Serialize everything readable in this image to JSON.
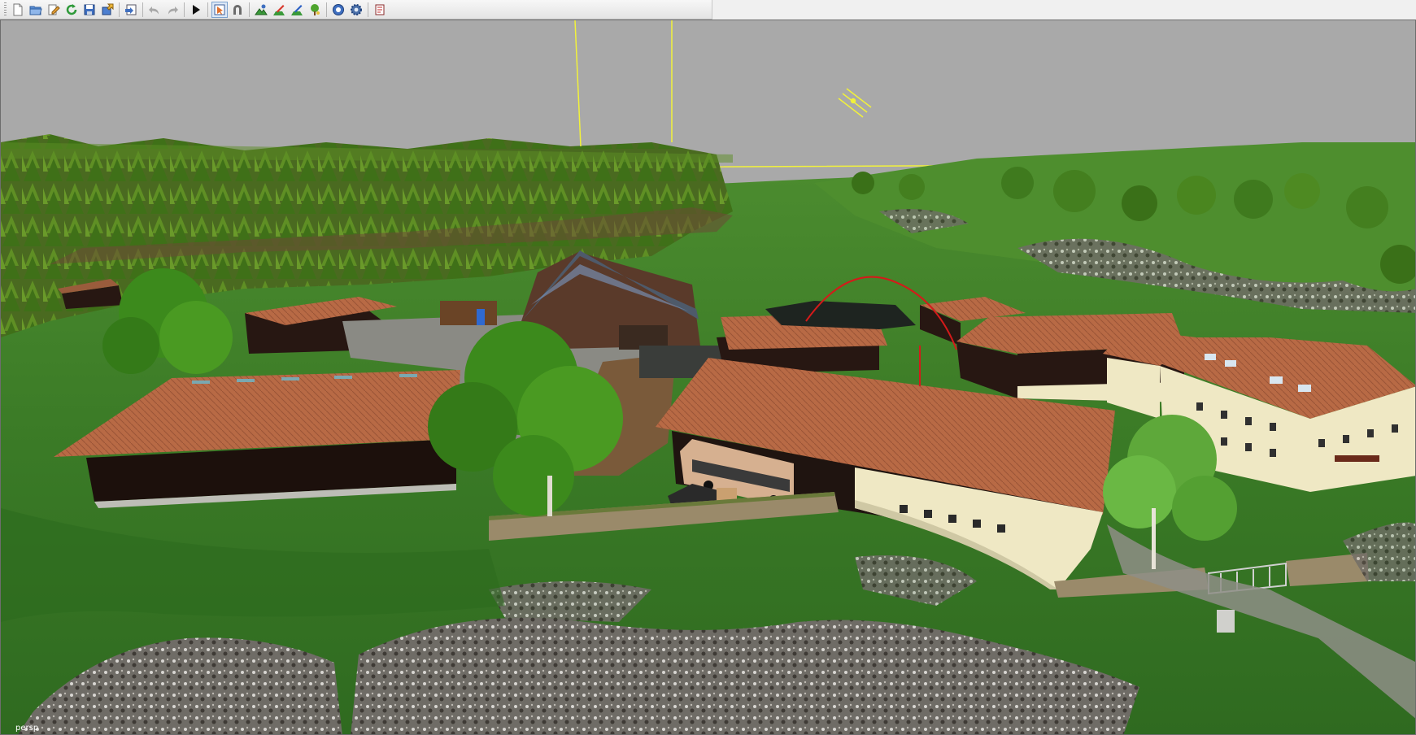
{
  "toolbar": {
    "buttons": [
      {
        "name": "new-file",
        "icon": "new-file-icon",
        "active": false
      },
      {
        "name": "open-file",
        "icon": "open-folder-icon",
        "active": false
      },
      {
        "name": "edit-file",
        "icon": "edit-file-icon",
        "active": false
      },
      {
        "name": "refresh",
        "icon": "refresh-icon",
        "active": false
      },
      {
        "name": "save",
        "icon": "save-icon",
        "active": false
      },
      {
        "name": "export",
        "icon": "export-icon",
        "active": false
      },
      {
        "name": "import",
        "icon": "import-icon",
        "active": false
      },
      {
        "name": "undo",
        "icon": "undo-icon",
        "active": false
      },
      {
        "name": "redo",
        "icon": "redo-icon",
        "active": false
      },
      {
        "name": "play",
        "icon": "play-icon",
        "active": false
      },
      {
        "name": "select-mode",
        "icon": "select-mode-icon",
        "active": true
      },
      {
        "name": "magnet",
        "icon": "magnet-icon",
        "active": false
      },
      {
        "name": "terrain-sculpt",
        "icon": "terrain-sculpt-icon",
        "active": false
      },
      {
        "name": "terrain-paint",
        "icon": "terrain-paint-icon",
        "active": false
      },
      {
        "name": "foliage-paint",
        "icon": "foliage-paint-icon",
        "active": false
      },
      {
        "name": "tree-paint",
        "icon": "tree-paint-icon",
        "active": false
      },
      {
        "name": "object-tool",
        "icon": "object-tool-icon",
        "active": false
      },
      {
        "name": "settings-tool",
        "icon": "gear-icon",
        "active": false
      },
      {
        "name": "scripts",
        "icon": "scripts-icon",
        "active": false
      }
    ]
  },
  "viewport": {
    "camera_label": "persp"
  },
  "colors": {
    "sky": "#a9a9a9",
    "grass": "#3f7a2a",
    "roof": "#b86a45",
    "wall_dark": "#241612",
    "wall_light": "#efe8c4",
    "forest": "#3d6d18",
    "gizmo_yellow": "#f2f23a",
    "gizmo_red": "#d41a1a"
  }
}
